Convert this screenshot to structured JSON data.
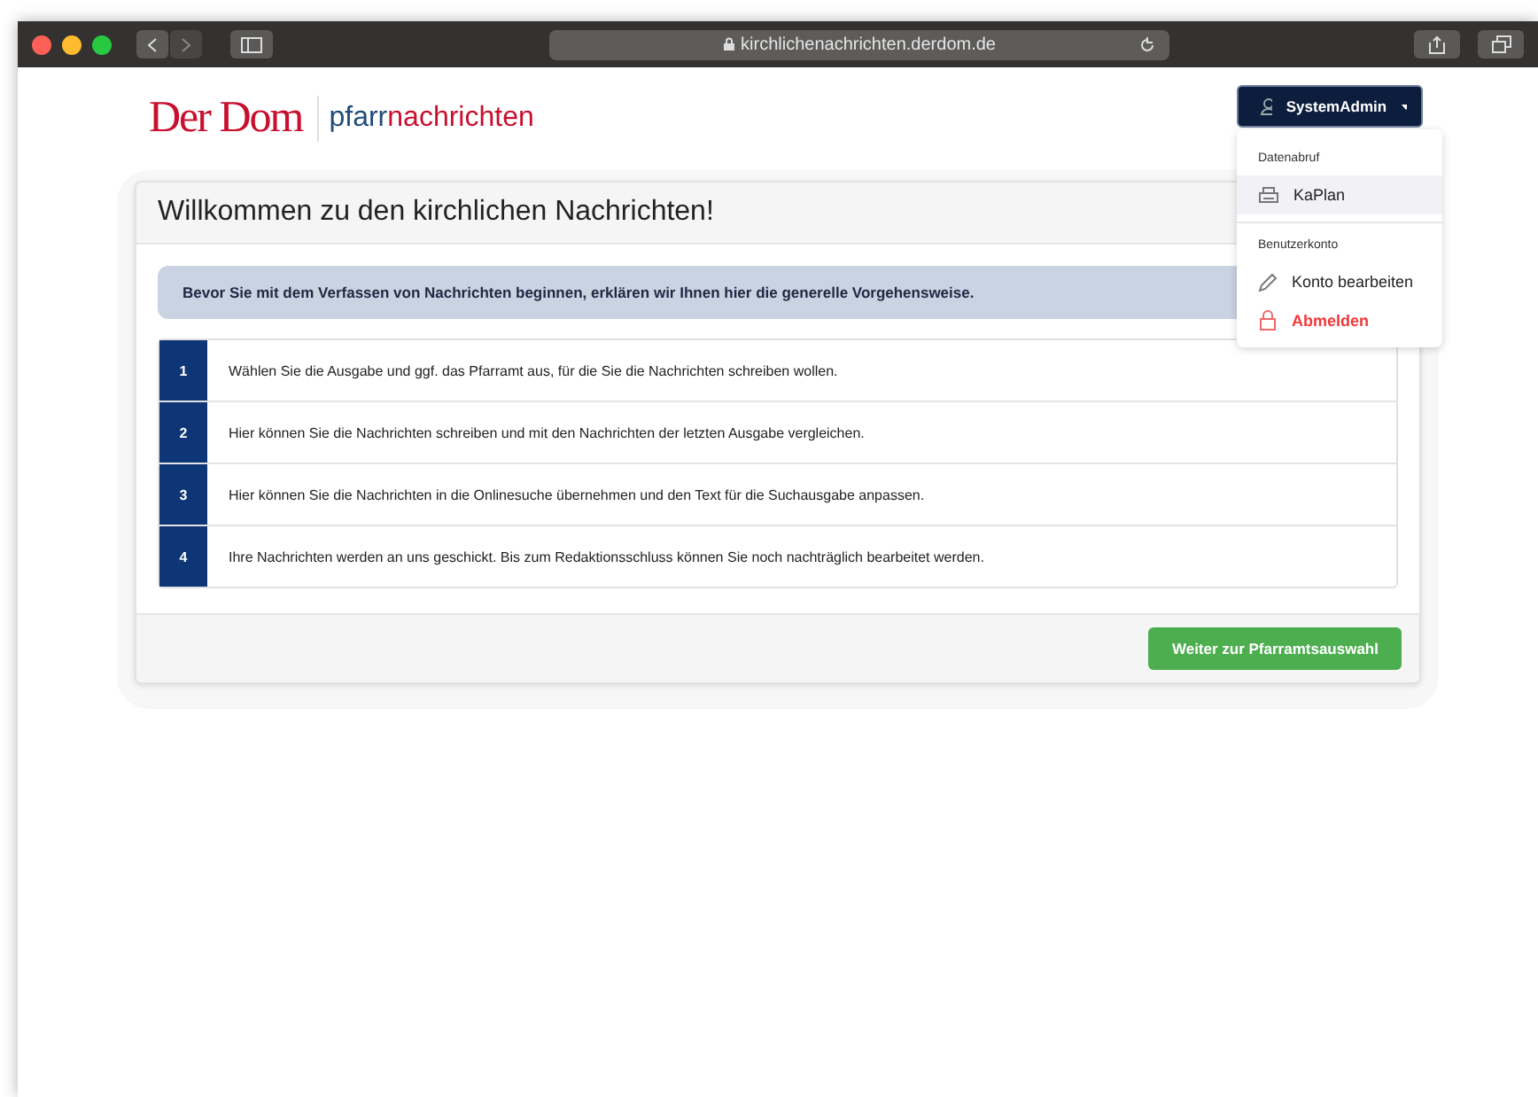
{
  "browser": {
    "url": "kirchlichenachrichten.derdom.de"
  },
  "logo": {
    "brand": "Der Dom",
    "product_first": "pfarr",
    "product_second": "nachrichten"
  },
  "user_menu": {
    "label": "SystemAdmin",
    "expanded": true,
    "sections": [
      {
        "heading": "Datenabruf",
        "items": [
          {
            "label": "KaPlan",
            "kind": "normal",
            "selected": true
          }
        ]
      },
      {
        "heading": "Benutzerkonto",
        "items": [
          {
            "label": "Konto bearbeiten",
            "kind": "normal",
            "selected": false
          },
          {
            "label": "Abmelden",
            "kind": "danger",
            "selected": false
          }
        ]
      }
    ]
  },
  "card": {
    "title": "Willkommen zu den kirchlichen Nachrichten!",
    "notice": "Bevor Sie mit dem Verfassen von Nachrichten beginnen, erklären wir Ihnen hier die generelle Vorgehensweise.",
    "steps": [
      {
        "number": "1",
        "text": "Wählen Sie die Ausgabe und ggf. das Pfarramt aus, für die Sie die Nachrichten schreiben wollen."
      },
      {
        "number": "2",
        "text": "Hier können Sie die Nachrichten schreiben und mit den Nachrichten der letzten Ausgabe vergleichen."
      },
      {
        "number": "3",
        "text": "Hier können Sie die Nachrichten in die Onlinesuche übernehmen und den Text für die Suchausgabe anpassen."
      },
      {
        "number": "4",
        "text": "Ihre Nachrichten werden an uns geschickt. Bis zum Redaktionsschluss können Sie noch nachträglich bearbeitet werden."
      }
    ],
    "button": "Weiter zur Pfarramtsauswahl"
  }
}
